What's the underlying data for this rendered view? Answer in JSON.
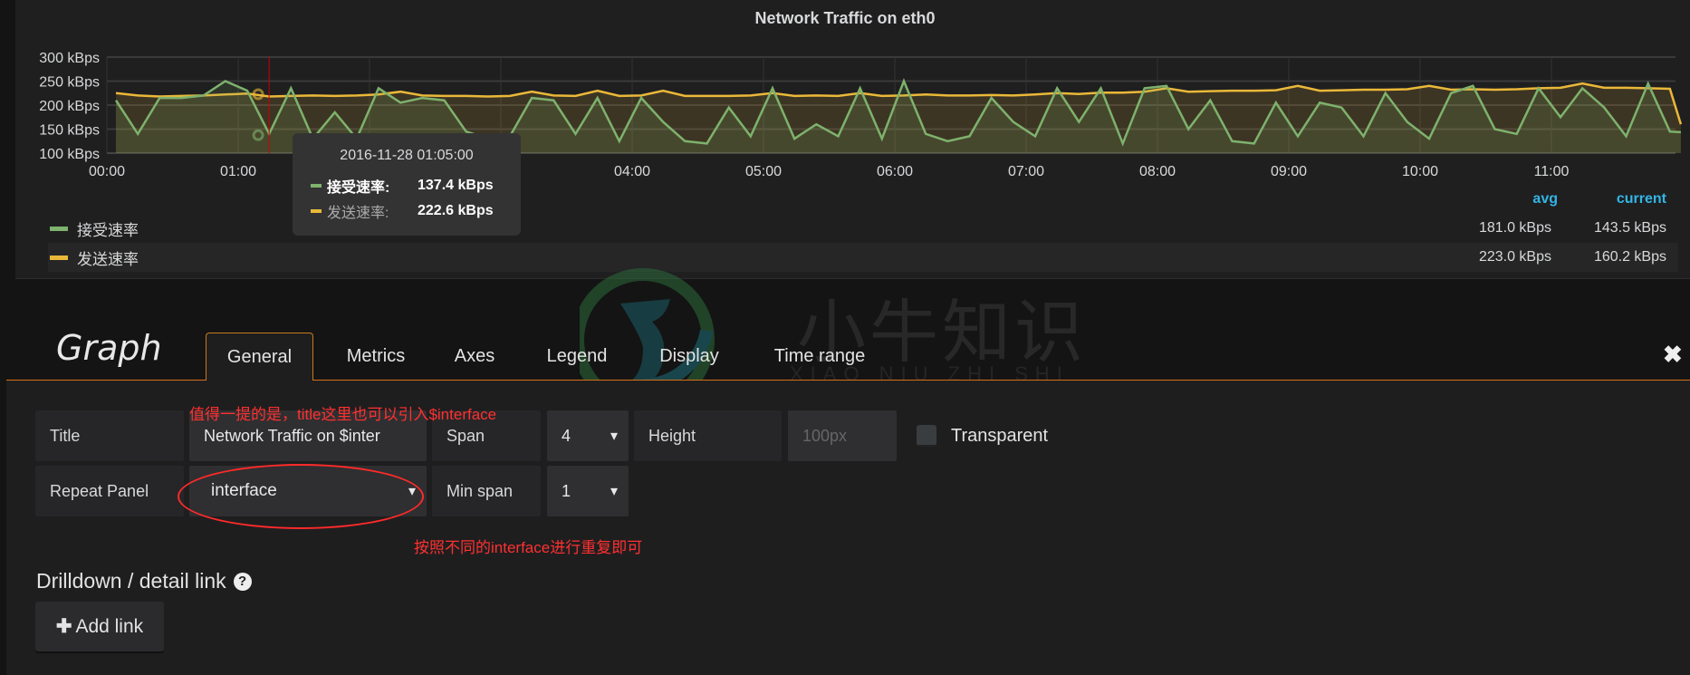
{
  "panel": {
    "title": "Network Traffic on eth0"
  },
  "chart_data": {
    "type": "line",
    "title": "Network Traffic on eth0",
    "y_ticks": [
      "300 kBps",
      "250 kBps",
      "200 kBps",
      "150 kBps",
      "100 kBps"
    ],
    "y_tick_values": [
      300,
      250,
      200,
      150,
      100
    ],
    "ylim": [
      100,
      300
    ],
    "x_ticks": [
      "00:00",
      "01:00",
      "02:00",
      "03:00",
      "04:00",
      "05:00",
      "06:00",
      "07:00",
      "08:00",
      "09:00",
      "10:00",
      "11:00"
    ],
    "x_tick_hours": [
      0,
      1,
      2,
      3,
      4,
      5,
      6,
      7,
      8,
      9,
      10,
      11
    ],
    "grid": true,
    "fill": true,
    "x": [
      "00:00",
      "00:10",
      "00:20",
      "00:30",
      "00:40",
      "00:50",
      "01:00",
      "01:10",
      "01:20",
      "01:30",
      "01:40",
      "01:50",
      "02:00",
      "02:10",
      "02:20",
      "02:30",
      "02:40",
      "02:50",
      "03:00",
      "03:10",
      "03:20",
      "03:30",
      "03:40",
      "03:50",
      "04:00",
      "04:10",
      "04:20",
      "04:30",
      "04:40",
      "04:50",
      "05:00",
      "05:10",
      "05:20",
      "05:30",
      "05:40",
      "05:50",
      "06:00",
      "06:10",
      "06:20",
      "06:30",
      "06:40",
      "06:50",
      "07:00",
      "07:10",
      "07:20",
      "07:30",
      "07:40",
      "07:50",
      "08:00",
      "08:10",
      "08:20",
      "08:30",
      "08:40",
      "08:50",
      "09:00",
      "09:10",
      "09:20",
      "09:30",
      "09:40",
      "09:50",
      "10:00",
      "10:10",
      "10:20",
      "10:30",
      "10:40",
      "10:50",
      "11:00",
      "11:10",
      "11:20",
      "11:30",
      "11:40",
      "11:50",
      "11:55"
    ],
    "series": [
      {
        "name": "接受速率",
        "color": "#7eb26d",
        "values": [
          210,
          140,
          215,
          215,
          220,
          250,
          230,
          140,
          235,
          130,
          185,
          130,
          235,
          205,
          215,
          210,
          145,
          130,
          135,
          215,
          210,
          140,
          215,
          125,
          215,
          165,
          125,
          120,
          195,
          135,
          235,
          130,
          160,
          135,
          235,
          130,
          250,
          140,
          125,
          135,
          215,
          165,
          135,
          235,
          165,
          235,
          120,
          235,
          240,
          150,
          210,
          125,
          120,
          205,
          135,
          205,
          195,
          135,
          225,
          165,
          130,
          225,
          240,
          150,
          140,
          235,
          175,
          235,
          195,
          135,
          245,
          145,
          143.5
        ]
      },
      {
        "name": "发送速率",
        "color": "#eab839",
        "values": [
          225,
          220,
          218,
          219,
          220,
          222,
          224,
          218,
          219,
          220,
          219,
          220,
          222,
          228,
          220,
          219,
          219,
          218,
          219,
          228,
          220,
          219,
          230,
          219,
          220,
          230,
          219,
          219,
          219,
          220,
          225,
          219,
          220,
          219,
          225,
          219,
          220,
          222,
          220,
          220,
          221,
          220,
          222,
          225,
          223,
          226,
          226,
          228,
          235,
          228,
          229,
          230,
          230,
          231,
          240,
          230,
          231,
          232,
          232,
          233,
          240,
          232,
          233,
          232,
          233,
          235,
          236,
          245,
          236,
          236,
          235,
          234,
          160.2
        ]
      }
    ],
    "hover": {
      "time": "2016-11-28 01:05:00",
      "values": [
        "137.4 kBps",
        "222.6 kBps"
      ]
    }
  },
  "legend": {
    "headers": {
      "avg": "avg",
      "current": "current"
    },
    "rows": [
      {
        "name": "接受速率",
        "color": "#7eb26d",
        "avg": "181.0 kBps",
        "current": "143.5 kBps"
      },
      {
        "name": "发送速率",
        "color": "#eab839",
        "avg": "223.0 kBps",
        "current": "160.2 kBps"
      }
    ]
  },
  "tooltip": {
    "time": "2016-11-28 01:05:00",
    "rows": [
      {
        "name": "接受速率:",
        "value": "137.4 kBps",
        "color": "#7eb26d"
      },
      {
        "name": "发送速率:",
        "value": "222.6 kBps",
        "color": "#eab839"
      }
    ]
  },
  "editor": {
    "heading": "Graph",
    "tabs": [
      "General",
      "Metrics",
      "Axes",
      "Legend",
      "Display",
      "Time range"
    ],
    "active_tab": "General",
    "close_icon": "close-icon",
    "form": {
      "title_label": "Title",
      "title_value": "Network Traffic on $inter",
      "span_label": "Span",
      "span_value": "4",
      "height_label": "Height",
      "height_placeholder": "100px",
      "transparent_label": "Transparent",
      "transparent_checked": false,
      "repeat_label": "Repeat Panel",
      "repeat_value": "interface",
      "minspan_label": "Min span",
      "minspan_value": "1"
    },
    "drilldown_heading": "Drilldown / detail link",
    "add_link_label": "Add link"
  },
  "annotations": {
    "note1": "值得一提的是，title这里也可以引入$interface",
    "note2": "按照不同的interface进行重复即可",
    "color": "#ff3030"
  },
  "watermark": {
    "text": "小牛知识库",
    "subtext": "XIAO NIU ZHI SHI KU"
  }
}
